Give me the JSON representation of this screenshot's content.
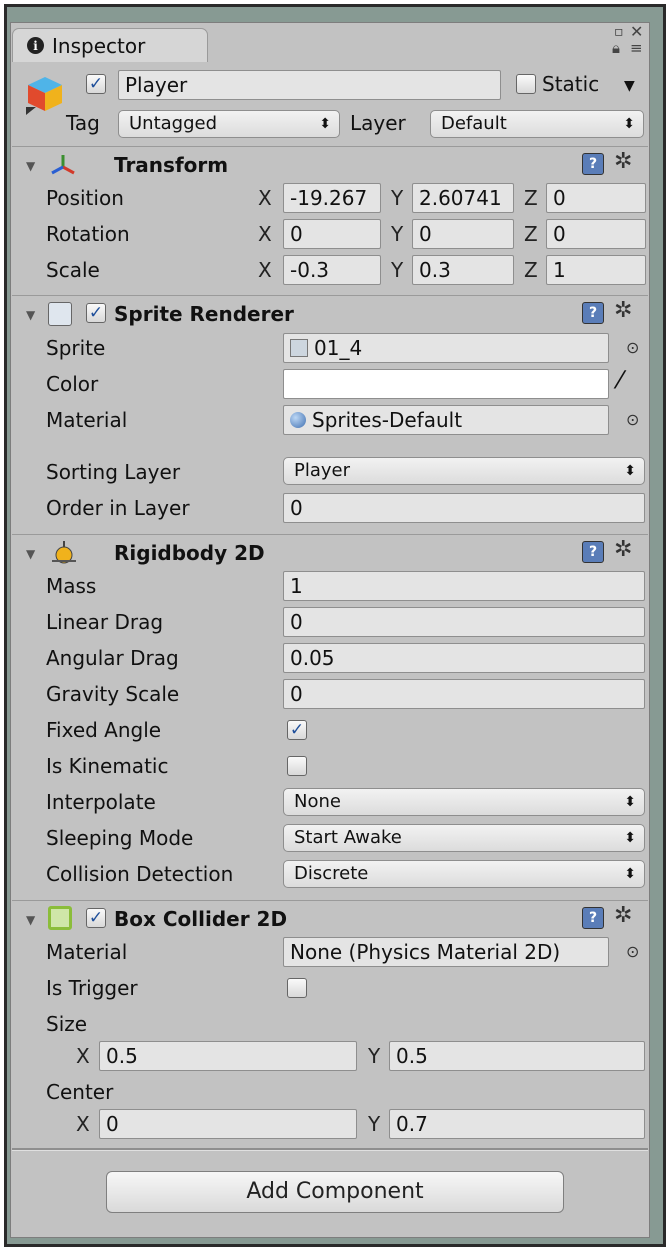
{
  "window": {
    "tab_title": "Inspector"
  },
  "gameobject": {
    "enabled": true,
    "name": "Player",
    "static_label": "Static",
    "tag_label": "Tag",
    "tag_value": "Untagged",
    "layer_label": "Layer",
    "layer_value": "Default"
  },
  "transform": {
    "title": "Transform",
    "rows": [
      {
        "label": "Position",
        "x": "-19.267",
        "y": "2.60741",
        "z": "0"
      },
      {
        "label": "Rotation",
        "x": "0",
        "y": "0",
        "z": "0"
      },
      {
        "label": "Scale",
        "x": "-0.3",
        "y": "0.3",
        "z": "1"
      }
    ],
    "axis_x": "X",
    "axis_y": "Y",
    "axis_z": "Z"
  },
  "sprite_renderer": {
    "title": "Sprite Renderer",
    "enabled": true,
    "sprite_label": "Sprite",
    "sprite_value": "01_4",
    "color_label": "Color",
    "color_value": "#ffffff",
    "material_label": "Material",
    "material_value": "Sprites-Default",
    "sorting_layer_label": "Sorting Layer",
    "sorting_layer_value": "Player",
    "order_label": "Order in Layer",
    "order_value": "0"
  },
  "rigidbody2d": {
    "title": "Rigidbody 2D",
    "mass_label": "Mass",
    "mass_value": "1",
    "linear_drag_label": "Linear Drag",
    "linear_drag_value": "0",
    "angular_drag_label": "Angular Drag",
    "angular_drag_value": "0.05",
    "gravity_label": "Gravity Scale",
    "gravity_value": "0",
    "fixed_angle_label": "Fixed Angle",
    "fixed_angle_checked": true,
    "kinematic_label": "Is Kinematic",
    "kinematic_checked": false,
    "interpolate_label": "Interpolate",
    "interpolate_value": "None",
    "sleeping_label": "Sleeping Mode",
    "sleeping_value": "Start Awake",
    "collision_label": "Collision Detection",
    "collision_value": "Discrete"
  },
  "box_collider2d": {
    "title": "Box Collider 2D",
    "enabled": true,
    "material_label": "Material",
    "material_value": "None (Physics Material 2D)",
    "trigger_label": "Is Trigger",
    "trigger_checked": false,
    "size_label": "Size",
    "size_x": "0.5",
    "size_y": "0.5",
    "center_label": "Center",
    "center_x": "0",
    "center_y": "0.7",
    "axis_x": "X",
    "axis_y": "Y"
  },
  "add_component_label": "Add Component",
  "icons": {
    "info": "i",
    "check": "✓",
    "dropdown_arrow": "⬍",
    "gear": "✲",
    "help": "?",
    "target": "⊙"
  },
  "colors": {
    "accent": "#5a7db8",
    "panel": "#c2c2c2",
    "field": "#e4e4e4"
  }
}
